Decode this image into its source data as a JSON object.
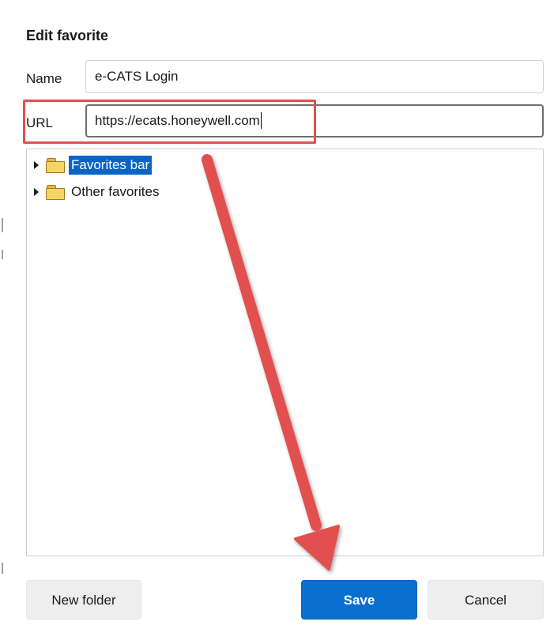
{
  "dialog": {
    "title": "Edit favorite"
  },
  "name_field": {
    "label": "Name",
    "value": "e-CATS Login"
  },
  "url_field": {
    "label": "URL",
    "value": "https://ecats.honeywell.com"
  },
  "folder_tree": {
    "items": [
      {
        "label": "Favorites bar",
        "icon": "folder-icon",
        "selected": true
      },
      {
        "label": "Other favorites",
        "icon": "folder-icon",
        "selected": false
      }
    ]
  },
  "buttons": {
    "new_folder": "New folder",
    "save": "Save",
    "cancel": "Cancel"
  },
  "colors": {
    "accent": "#0b6fd0",
    "selection": "#0a64c8",
    "annotation": "#e2504f",
    "folder": "#f6d365"
  },
  "annotations": {
    "highlight": "url-field",
    "arrow_target": "save-button"
  }
}
